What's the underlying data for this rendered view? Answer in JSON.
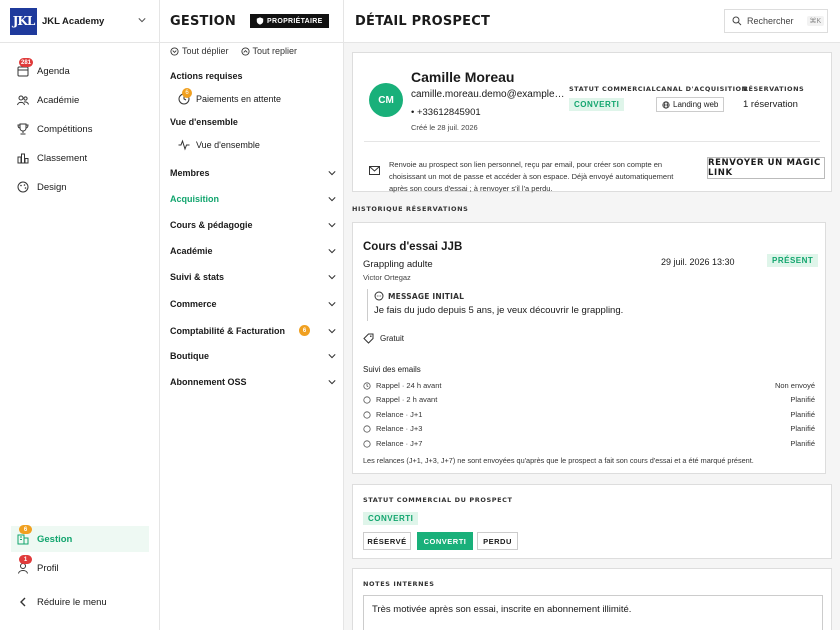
{
  "brand": {
    "logo": "JKL",
    "name": "JKL Academy"
  },
  "sidebar": {
    "items": [
      {
        "label": "Agenda",
        "icon": "calendar-icon",
        "badge": "281"
      },
      {
        "label": "Académie",
        "icon": "users-icon"
      },
      {
        "label": "Compétitions",
        "icon": "trophy-icon"
      },
      {
        "label": "Classement",
        "icon": "ranking-icon"
      },
      {
        "label": "Design",
        "icon": "palette-icon"
      }
    ],
    "bottom": [
      {
        "label": "Gestion",
        "icon": "building-icon",
        "badge": "6"
      },
      {
        "label": "Profil",
        "icon": "user-icon",
        "badge": "1"
      }
    ],
    "collapse_label": "Réduire le menu"
  },
  "gestion": {
    "title": "GESTION",
    "owner_badge": "PROPRIÉTAIRE",
    "expand_all": "Tout déplier",
    "collapse_all": "Tout replier",
    "actions_title": "Actions requises",
    "pending_payments": "Paiements en attente",
    "pending_badge": "6",
    "overview_title": "Vue d'ensemble",
    "overview_item": "Vue d'ensemble",
    "menus": [
      {
        "label": "Membres"
      },
      {
        "label": "Acquisition"
      },
      {
        "label": "Cours & pédagogie"
      },
      {
        "label": "Académie"
      },
      {
        "label": "Suivi & stats"
      },
      {
        "label": "Commerce"
      },
      {
        "label": "Comptabilité & Facturation",
        "badge": "6"
      },
      {
        "label": "Boutique"
      },
      {
        "label": "Abonnement OSS"
      }
    ]
  },
  "main": {
    "title": "DÉTAIL PROSPECT",
    "search_placeholder": "Rechercher",
    "search_kbd": "⌘K"
  },
  "prospect": {
    "initials": "CM",
    "name": "Camille Moreau",
    "email": "camille.moreau.demo@example.com",
    "phone": "+33612845901",
    "created": "Créé le 28 juil. 2026",
    "commercial_status_label": "STATUT COMMERCIAL",
    "commercial_status": "CONVERTI",
    "channel_label": "CANAL D'ACQUISITION",
    "channel": "Landing web",
    "reservations_label": "RÉSERVATIONS",
    "reservations": "1 réservation",
    "magic_text": "Renvoie au prospect son lien personnel, reçu par email, pour créer son compte en choisissant un mot de passe et accéder à son espace. Déjà envoyé automatiquement après son cours d'essai ; à renvoyer s'il l'a perdu.",
    "magic_button": "RENVOYER UN MAGIC LINK"
  },
  "history": {
    "label": "HISTORIQUE RÉSERVATIONS",
    "course": "Cours d'essai JJB",
    "discipline": "Grappling adulte",
    "coach": "Victor Ortegaz",
    "datetime": "29 juil. 2026 13:30",
    "presence": "PRÉSENT",
    "message_label": "MESSAGE INITIAL",
    "message": "Je fais du judo depuis 5 ans, je veux découvrir le grappling.",
    "price": "Gratuit",
    "emails_title": "Suivi des emails",
    "emails": [
      {
        "label": "Rappel · 24 h avant",
        "status": "Non envoyé"
      },
      {
        "label": "Rappel · 2 h avant",
        "status": "Planifié"
      },
      {
        "label": "Relance · J+1",
        "status": "Planifié"
      },
      {
        "label": "Relance · J+3",
        "status": "Planifié"
      },
      {
        "label": "Relance · J+7",
        "status": "Planifié"
      }
    ],
    "footnote": "Les relances (J+1, J+3, J+7) ne sont envoyées qu'après que le prospect a fait son cours d'essai et a été marqué présent."
  },
  "status_card": {
    "label": "STATUT COMMERCIAL DU PROSPECT",
    "current": "CONVERTI",
    "options": [
      "RÉSERVÉ",
      "CONVERTI",
      "PERDU"
    ]
  },
  "notes": {
    "label": "NOTES INTERNES",
    "value": "Très motivée après son essai, inscrite en abonnement illimité."
  },
  "colors": {
    "accent": "#19b07a",
    "brand": "#1f3a9c",
    "badge_red": "#e03b3b",
    "badge_orange": "#f0a020"
  }
}
